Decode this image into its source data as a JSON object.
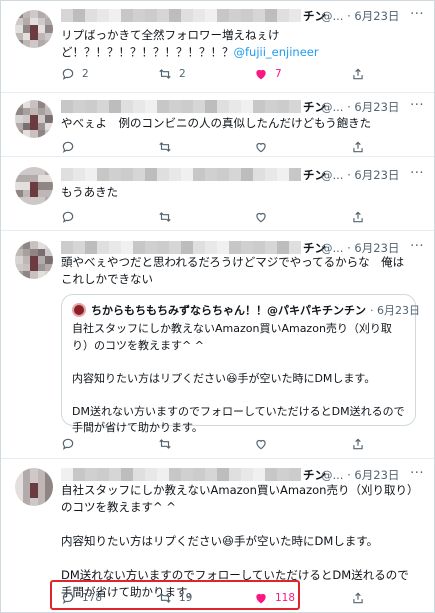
{
  "tweets": [
    {
      "id": "t1",
      "name_suffix": "チン",
      "handle_time": "@... · 6月23日",
      "text": "リプばっかきて全然フォロワー増えねぇけど！？！？！？！？！？！？！？",
      "mention": "@fujii_enjineer",
      "reply": "2",
      "retweet": "2",
      "like": "7",
      "liked": true
    },
    {
      "id": "t2",
      "name_suffix": "チン",
      "handle_time": "@... · 6月23日",
      "text": "やべぇよ　例のコンビニの人の真似したんだけどもう飽きた",
      "reply": "",
      "retweet": "",
      "like": "",
      "liked": false
    },
    {
      "id": "t3",
      "name_suffix": "チン",
      "handle_time": "@... · 6月23日",
      "text": "もうあきた",
      "reply": "",
      "retweet": "",
      "like": "",
      "liked": false
    },
    {
      "id": "t4",
      "name_suffix": "チン",
      "handle_time": "@... · 6月23日",
      "text": "頭やべぇやつだと思われるだろうけどマジでやってるからな　俺はこれしかできない",
      "quote": {
        "name": "ちからもちもちみずならちゃん！！@パキパキチンチン",
        "time": "· 6月23日",
        "text": "自社スタッフにしか教えないAmazon買いAmazon売り（刈り取り）のコツを教えます^ ^\n\n内容知りたい方はリプください😆手が空いた時にDMします。\n\nDM送れない方いますのでフォローしていただけるとDM送れるので手間が省けて助かります。"
      },
      "reply": "",
      "retweet": "",
      "like": "",
      "liked": false
    },
    {
      "id": "t5",
      "name_suffix": "チン",
      "handle_time": "@... · 6月23日",
      "text": "自社スタッフにしか教えないAmazon買いAmazon売り（刈り取り）のコツを教えます^ ^\n\n内容知りたい方はリプください😆手が空いた時にDMします。\n\nDM送れない方いますのでフォローしていただけるとDM送れるので手間が省けて助かります。",
      "reply": "178",
      "retweet": "19",
      "like": "118",
      "liked": true
    }
  ],
  "menu_glyph": "···",
  "colors": {
    "like": "#f91880",
    "mention": "#1d9bf0",
    "highlight": "#e0242b",
    "muted": "#536471"
  },
  "icons": [
    "reply-icon",
    "retweet-icon",
    "like-icon",
    "share-icon",
    "more-icon"
  ]
}
